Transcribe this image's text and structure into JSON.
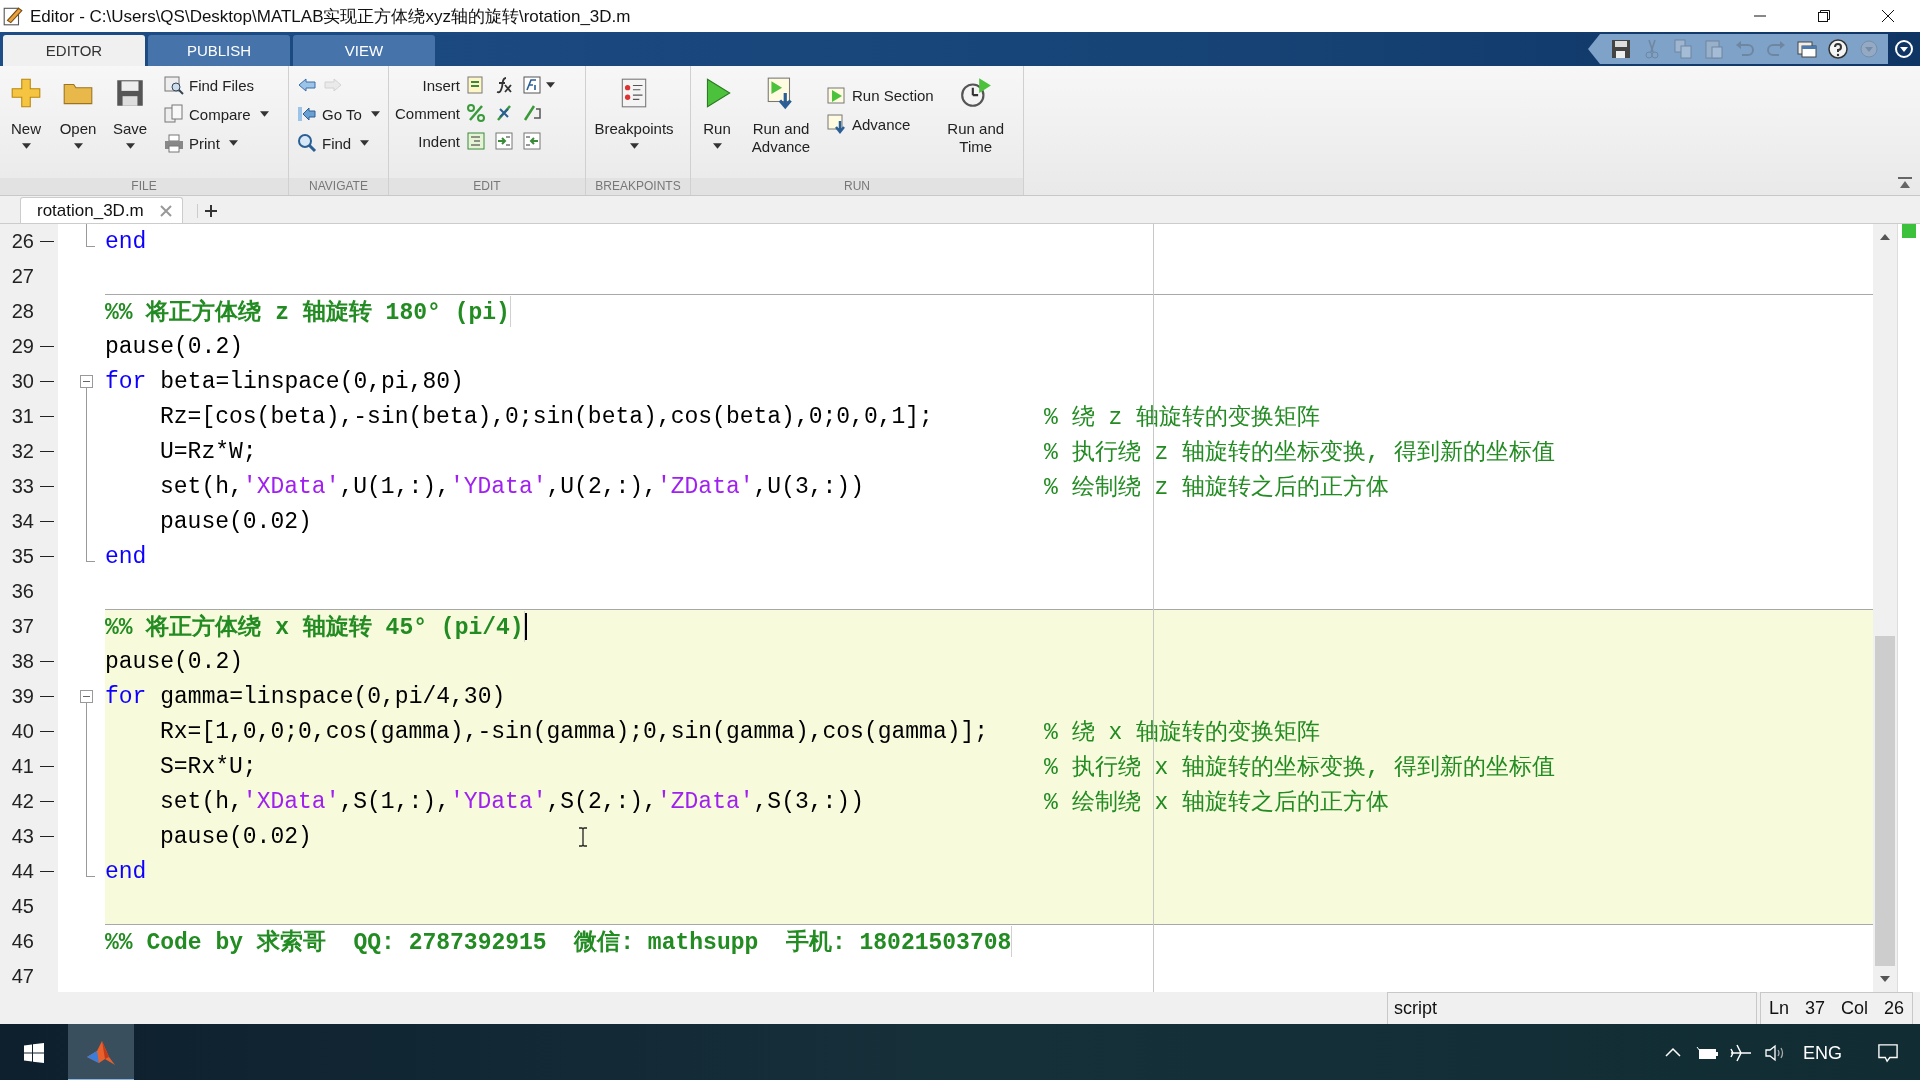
{
  "window": {
    "title": "Editor - C:\\Users\\QS\\Desktop\\MATLAB实现正方体绕xyz轴的旋转\\rotation_3D.m"
  },
  "tabs": [
    {
      "label": "EDITOR",
      "selected": true
    },
    {
      "label": "PUBLISH",
      "selected": false
    },
    {
      "label": "VIEW",
      "selected": false
    }
  ],
  "quick_access": [
    {
      "kind": "save",
      "disabled": false
    },
    {
      "kind": "cut",
      "disabled": true
    },
    {
      "kind": "copy",
      "disabled": true
    },
    {
      "kind": "paste",
      "disabled": true
    },
    {
      "kind": "undo",
      "disabled": true
    },
    {
      "kind": "redo",
      "disabled": true
    },
    {
      "kind": "windows",
      "disabled": false
    },
    {
      "kind": "help",
      "disabled": false
    },
    {
      "kind": "dropdown",
      "disabled": true
    }
  ],
  "toolstrip": {
    "file": {
      "label": "FILE",
      "new": "New",
      "open": "Open",
      "save": "Save",
      "find_files": "Find Files",
      "compare": "Compare",
      "print": "Print"
    },
    "navigate": {
      "label": "NAVIGATE",
      "go_to": "Go To",
      "find": "Find"
    },
    "edit": {
      "label": "EDIT",
      "insert": "Insert",
      "comment": "Comment",
      "indent": "Indent"
    },
    "breakpoints": {
      "label": "BREAKPOINTS",
      "breakpoints": "Breakpoints"
    },
    "run": {
      "label": "RUN",
      "run": "Run",
      "run_and_advance": "Run and Advance",
      "run_section": "Run Section",
      "advance": "Advance",
      "run_and_time": "Run and Time"
    }
  },
  "file_tabs": [
    {
      "label": "rotation_3D.m",
      "selected": true
    }
  ],
  "editor": {
    "lines": [
      {
        "num": "26",
        "exec": true,
        "kind": "fold_end",
        "indented": false,
        "cell": false,
        "caret": false,
        "parts": [
          {
            "kind": "keyword",
            "text": "end"
          }
        ]
      },
      {
        "num": "27",
        "exec": false,
        "kind": "plain",
        "cell": false,
        "caret": false
      },
      {
        "num": "28",
        "exec": false,
        "kind": "plain",
        "indented": false,
        "cell": false,
        "caret": false,
        "parts": [
          {
            "kind": "section",
            "text": "%% 将正方体绕 z 轴旋转 180° (pi)"
          }
        ]
      },
      {
        "num": "29",
        "exec": true,
        "kind": "plain",
        "indented": false,
        "cell": false,
        "caret": false,
        "parts": [
          {
            "kind": "code",
            "text": "pause(0.2)"
          }
        ]
      },
      {
        "num": "30",
        "exec": true,
        "kind": "fold_start",
        "indented": false,
        "cell": false,
        "caret": false,
        "parts": [
          {
            "kind": "keyword",
            "text": "for"
          },
          {
            "kind": "code",
            "text": " beta=linspace(0,pi,80)"
          }
        ]
      },
      {
        "num": "31",
        "exec": true,
        "kind": "fold_body",
        "indented": true,
        "cell": false,
        "caret": false,
        "parts": [
          {
            "kind": "code",
            "text": "Rz=[cos(beta),-sin(beta),0;sin(beta),cos(beta),0;0,0,1];"
          }
        ],
        "comment": "% 绕 z 轴旋转的变换矩阵"
      },
      {
        "num": "32",
        "exec": true,
        "kind": "fold_body",
        "indented": true,
        "cell": false,
        "caret": false,
        "parts": [
          {
            "kind": "code",
            "text": "U=Rz*W;"
          }
        ],
        "comment": "% 执行绕 z 轴旋转的坐标变换, 得到新的坐标值"
      },
      {
        "num": "33",
        "exec": true,
        "kind": "fold_body",
        "indented": true,
        "cell": false,
        "caret": false,
        "parts": [
          {
            "kind": "code",
            "text": "set(h,"
          },
          {
            "kind": "string",
            "text": "'XData'"
          },
          {
            "kind": "code",
            "text": ",U(1,:),"
          },
          {
            "kind": "string",
            "text": "'YData'"
          },
          {
            "kind": "code",
            "text": ",U(2,:),"
          },
          {
            "kind": "string",
            "text": "'ZData'"
          },
          {
            "kind": "code",
            "text": ",U(3,:))"
          }
        ],
        "comment": "% 绘制绕 z 轴旋转之后的正方体"
      },
      {
        "num": "34",
        "exec": true,
        "kind": "fold_body",
        "indented": true,
        "cell": false,
        "caret": false,
        "parts": [
          {
            "kind": "code",
            "text": "pause(0.02)"
          }
        ]
      },
      {
        "num": "35",
        "exec": true,
        "kind": "fold_end",
        "indented": false,
        "cell": false,
        "caret": false,
        "parts": [
          {
            "kind": "keyword",
            "text": "end"
          }
        ]
      },
      {
        "num": "36",
        "exec": false,
        "kind": "plain",
        "cell": false,
        "caret": false
      },
      {
        "num": "37",
        "exec": false,
        "kind": "plain",
        "indented": false,
        "cell": true,
        "caret": true,
        "parts": [
          {
            "kind": "section",
            "text": "%% 将正方体绕 x 轴旋转 45° (pi/4)"
          }
        ]
      },
      {
        "num": "38",
        "exec": true,
        "kind": "plain",
        "indented": false,
        "cell": true,
        "caret": false,
        "parts": [
          {
            "kind": "code",
            "text": "pause(0.2)"
          }
        ]
      },
      {
        "num": "39",
        "exec": true,
        "kind": "fold_start",
        "indented": false,
        "cell": true,
        "caret": false,
        "parts": [
          {
            "kind": "keyword",
            "text": "for"
          },
          {
            "kind": "code",
            "text": " gamma=linspace(0,pi/4,30)"
          }
        ]
      },
      {
        "num": "40",
        "exec": true,
        "kind": "fold_body",
        "indented": true,
        "cell": true,
        "caret": false,
        "parts": [
          {
            "kind": "code",
            "text": "Rx=[1,0,0;0,cos(gamma),-sin(gamma);0,sin(gamma),cos(gamma)];"
          }
        ],
        "comment": "% 绕 x 轴旋转的变换矩阵"
      },
      {
        "num": "41",
        "exec": true,
        "kind": "fold_body",
        "indented": true,
        "cell": true,
        "caret": false,
        "parts": [
          {
            "kind": "code",
            "text": "S=Rx*U;"
          }
        ],
        "comment": "% 执行绕 x 轴旋转的坐标变换, 得到新的坐标值"
      },
      {
        "num": "42",
        "exec": true,
        "kind": "fold_body",
        "indented": true,
        "cell": true,
        "caret": false,
        "parts": [
          {
            "kind": "code",
            "text": "set(h,"
          },
          {
            "kind": "string",
            "text": "'XData'"
          },
          {
            "kind": "code",
            "text": ",S(1,:),"
          },
          {
            "kind": "string",
            "text": "'YData'"
          },
          {
            "kind": "code",
            "text": ",S(2,:),"
          },
          {
            "kind": "string",
            "text": "'ZData'"
          },
          {
            "kind": "code",
            "text": ",S(3,:))"
          }
        ],
        "comment": "% 绘制绕 x 轴旋转之后的正方体"
      },
      {
        "num": "43",
        "exec": true,
        "kind": "fold_body",
        "indented": true,
        "cell": true,
        "caret": false,
        "parts": [
          {
            "kind": "code",
            "text": "pause(0.02)"
          }
        ]
      },
      {
        "num": "44",
        "exec": true,
        "kind": "fold_end",
        "indented": false,
        "cell": true,
        "caret": false,
        "parts": [
          {
            "kind": "keyword",
            "text": "end"
          }
        ]
      },
      {
        "num": "45",
        "exec": false,
        "kind": "plain",
        "cell": true,
        "caret": false
      },
      {
        "num": "46",
        "exec": false,
        "kind": "plain",
        "indented": false,
        "cell": false,
        "caret": false,
        "parts": [
          {
            "kind": "section",
            "text": "%% Code by 求索哥  QQ: 2787392915  微信: mathsupp  手机: 18021503708"
          }
        ]
      },
      {
        "num": "47",
        "exec": false,
        "kind": "plain",
        "cell": false,
        "caret": false
      }
    ]
  },
  "status_bar": {
    "file_type": "script",
    "ln_label": "Ln",
    "ln": "37",
    "col_label": "Col",
    "col": "26"
  },
  "taskbar": {
    "language": "ENG"
  }
}
